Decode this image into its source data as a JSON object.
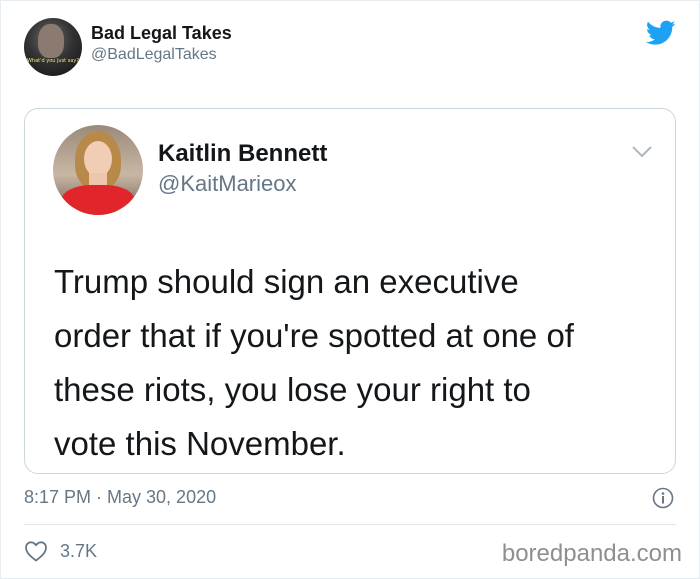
{
  "tweet": {
    "author": {
      "display_name": "Bad Legal Takes",
      "handle": "@BadLegalTakes",
      "avatar_caption": "What'd you just say?",
      "avatar_icon": "avatar-image"
    },
    "logo_icon": "twitter-bird-icon",
    "brand_color": "#1da1f2",
    "quoted": {
      "display_name": "Kaitlin Bennett",
      "handle": "@KaitMarieox",
      "menu_icon": "chevron-down-icon",
      "text_lines": [
        "Trump should sign an executive",
        "order that if you're spotted at one of",
        "these riots, you lose your right to",
        "vote this November."
      ]
    },
    "timestamp": "8:17 PM · May 30, 2020",
    "info_icon": "info-icon",
    "likes": {
      "icon": "heart-icon",
      "count": "3.7K"
    }
  },
  "watermark": "boredpanda.com"
}
